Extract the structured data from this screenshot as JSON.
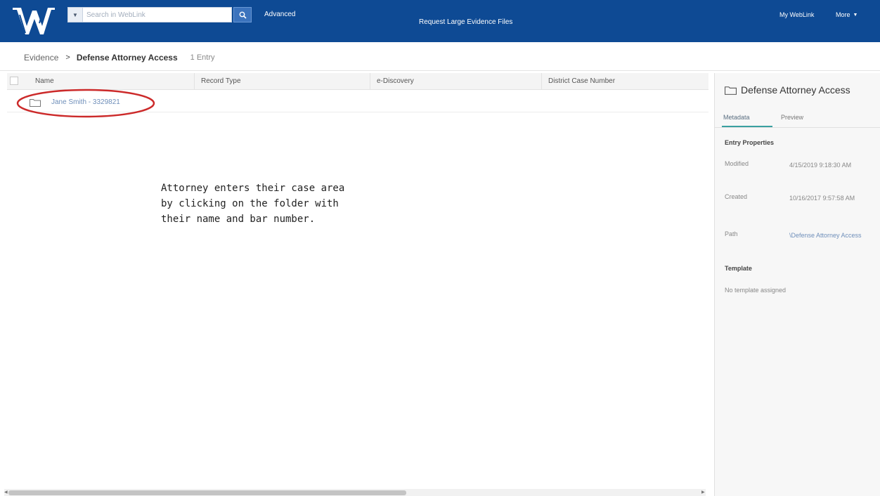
{
  "topbar": {
    "search_placeholder": "Search in WebLink",
    "advanced_label": "Advanced",
    "request_label": "Request Large Evidence Files",
    "my_weblink_label": "My WebLink",
    "more_label": "More"
  },
  "breadcrumb": {
    "root": "Evidence",
    "current": "Defense Attorney Access",
    "count": "1 Entry"
  },
  "table": {
    "columns": [
      "Name",
      "Record Type",
      "e-Discovery",
      "District Case Number"
    ],
    "rows": [
      {
        "name": "Jane Smith - 3329821"
      }
    ]
  },
  "annotation": {
    "line1": "Attorney enters their case area",
    "line2": "by clicking on the folder with",
    "line3": "their name and bar number."
  },
  "panel": {
    "title": "Defense Attorney Access",
    "tabs": [
      "Metadata",
      "Preview"
    ],
    "entry_properties_heading": "Entry Properties",
    "properties": [
      {
        "label": "Modified",
        "value": "4/15/2019 9:18:30 AM"
      },
      {
        "label": "Created",
        "value": "10/16/2017 9:57:58 AM"
      },
      {
        "label": "Path",
        "value": "\\Defense Attorney Access"
      }
    ],
    "template_heading": "Template",
    "template_value": "No template assigned"
  },
  "colors": {
    "topbar": "#0e4a94",
    "link": "#6f8fba",
    "highlight_oval": "#cc2a2a",
    "tab_underline": "#3aa0a0"
  },
  "icons": [
    "weblink-logo",
    "search-icon",
    "folder-icon",
    "chevron-down-icon"
  ]
}
